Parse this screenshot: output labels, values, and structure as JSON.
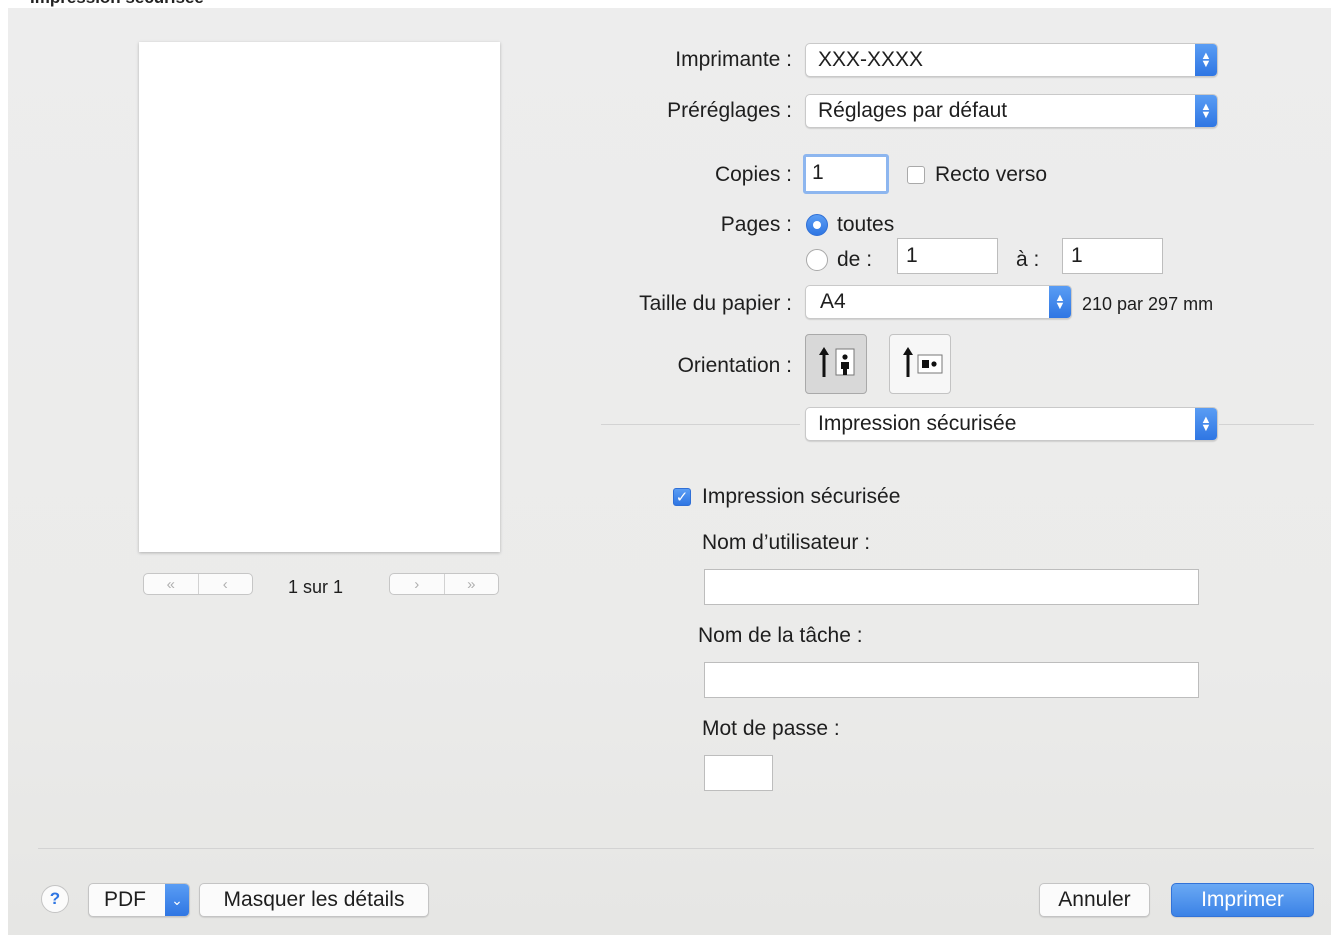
{
  "page_heading": "Impression sécurisée",
  "preview": {
    "page_indicator": "1 sur 1",
    "nav_first": "«",
    "nav_prev": "‹",
    "nav_next": "›",
    "nav_last": "»"
  },
  "printer": {
    "label": "Imprimante :",
    "value": "XXX-XXXX"
  },
  "presets": {
    "label": "Préréglages :",
    "value": "Réglages par défaut"
  },
  "copies": {
    "label": "Copies :",
    "value": "1",
    "duplex_label": "Recto verso",
    "duplex_checked": false
  },
  "pages": {
    "label": "Pages :",
    "all_label": "toutes",
    "range_label": "de :",
    "from_value": "1",
    "to_label": "à :",
    "to_value": "1",
    "selected": "all"
  },
  "paper_size": {
    "label": "Taille du papier :",
    "value": "A4",
    "dimensions": "210 par 297 mm"
  },
  "orientation": {
    "label": "Orientation :",
    "selected": "portrait"
  },
  "section_menu": {
    "value": "Impression sécurisée"
  },
  "secure_print": {
    "checkbox_label": "Impression sécurisée",
    "checked": true,
    "username_label": "Nom d’utilisateur :",
    "username_value": "",
    "jobname_label": "Nom de la tâche :",
    "jobname_value": "",
    "password_label": "Mot de passe :",
    "password_value": ""
  },
  "footer": {
    "help_label": "?",
    "pdf_label": "PDF",
    "hide_details_label": "Masquer les détails",
    "cancel_label": "Annuler",
    "print_label": "Imprimer"
  },
  "colors": {
    "accent": "#2f76e3",
    "dialog_bg": "#ececec"
  }
}
